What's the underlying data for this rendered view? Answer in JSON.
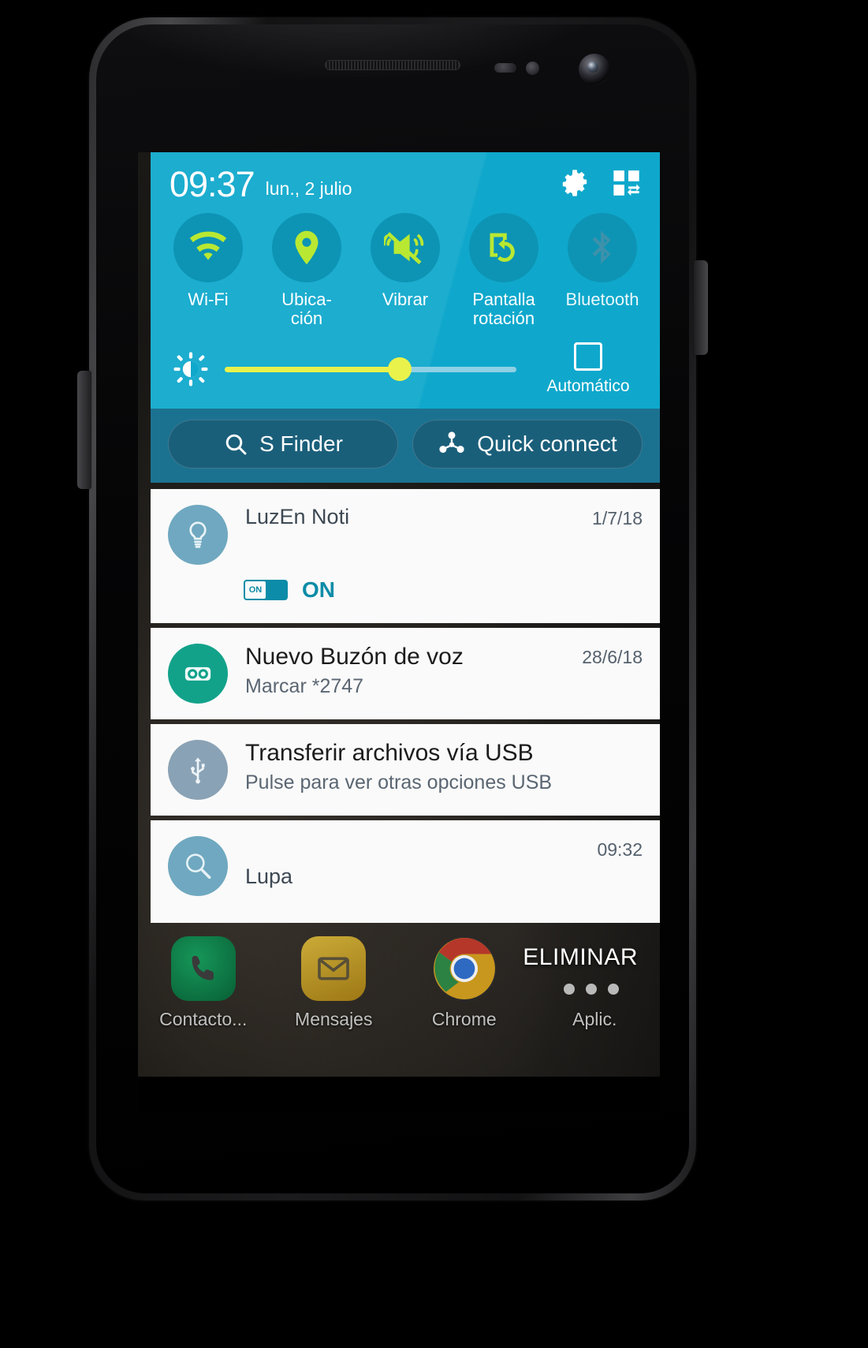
{
  "statusbar": {
    "clock": "09:37",
    "date": "lun., 2 julio",
    "settings_icon": "gear-icon",
    "grid_icon": "quick-settings-grid-icon"
  },
  "quick_toggles": [
    {
      "label": "Wi-Fi",
      "icon": "wifi-icon",
      "state": "on"
    },
    {
      "label": "Ubica-\nción",
      "label_line1": "Ubica-",
      "label_line2": "ción",
      "icon": "location-pin-icon",
      "state": "on"
    },
    {
      "label": "Vibrar",
      "icon": "vibrate-mute-icon",
      "state": "on"
    },
    {
      "label": "Pantalla\nrotación",
      "label_line1": "Pantalla",
      "label_line2": "rotación",
      "icon": "screen-rotation-icon",
      "state": "on"
    },
    {
      "label": "Bluetooth",
      "icon": "bluetooth-icon",
      "state": "off"
    }
  ],
  "brightness": {
    "icon": "brightness-sun-icon",
    "value_percent": 60,
    "auto_label": "Automático",
    "auto_checked": false
  },
  "shortcuts": [
    {
      "label": "S Finder",
      "icon": "search-icon"
    },
    {
      "label": "Quick connect",
      "icon": "quick-connect-icon"
    }
  ],
  "notifications": [
    {
      "id": "luzen-noti",
      "icon": "lightbulb-icon",
      "avatar_color": "#6fa8c0",
      "title": "LuzEn Noti",
      "subtitle": "",
      "time": "1/7/18",
      "has_toggle": true,
      "toggle_state_label": "ON",
      "toggle_switch_label": "ON"
    },
    {
      "id": "voicemail",
      "icon": "voicemail-icon",
      "avatar_color": "#12a28a",
      "title": "Nuevo Buzón de voz",
      "subtitle": "Marcar *2747",
      "time": "28/6/18",
      "has_toggle": false
    },
    {
      "id": "usb-transfer",
      "icon": "usb-icon",
      "avatar_color": "#8aa2b5",
      "title": "Transferir archivos vía USB",
      "subtitle": "Pulse para ver otras opciones USB",
      "time": "",
      "has_toggle": false
    },
    {
      "id": "lupa",
      "icon": "magnifier-icon",
      "avatar_color": "#6fa8c0",
      "title": "Lupa",
      "subtitle": "",
      "time": "09:32",
      "has_toggle": false
    }
  ],
  "clear_button": {
    "label": "ELIMINAR"
  },
  "dock": [
    {
      "label": "Contacto...",
      "icon": "phone-icon",
      "color": "#0a7a48"
    },
    {
      "label": "Mensajes",
      "icon": "mail-icon",
      "color": "#c9a227"
    },
    {
      "label": "Chrome",
      "icon": "chrome-icon",
      "color": "#4285f4"
    },
    {
      "label": "Aplic.",
      "icon": "apps-grid-icon",
      "color": "#9a9a9a"
    }
  ],
  "colors": {
    "panel_cyan": "#0fa8cc",
    "toggle_circle": "#0d94b4",
    "toggle_active_green": "#b9e832",
    "toggle_inactive": "#4d9fb6",
    "finder_band": "#1b7290",
    "pill": "#1a5f7a",
    "slider_yellow": "#e9f24b",
    "accent_teal": "#0c8ca8"
  }
}
